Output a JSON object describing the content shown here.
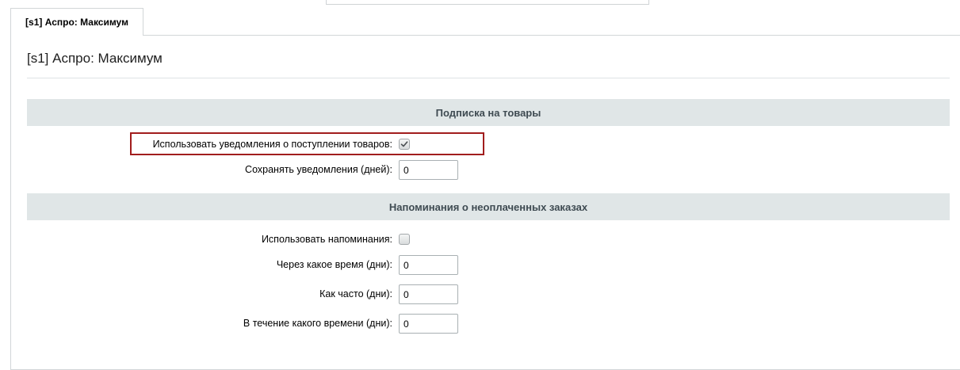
{
  "tabs": [
    {
      "label": "[s1] Аспро: Максимум",
      "active": true
    }
  ],
  "panel": {
    "title": "[s1] Аспро: Максимум"
  },
  "sections": {
    "subscribe": {
      "header": "Подписка на товары",
      "use_notifications_label": "Использовать уведомления о поступлении товаров:",
      "use_notifications_checked": true,
      "keep_days_label": "Сохранять уведомления (дней):",
      "keep_days_value": "0"
    },
    "reminders": {
      "header": "Напоминания о неоплаченных заказах",
      "use_reminders_label": "Использовать напоминания:",
      "use_reminders_checked": false,
      "after_label": "Через какое время (дни):",
      "after_value": "0",
      "frequency_label": "Как часто (дни):",
      "frequency_value": "0",
      "during_label": "В течение какого времени (дни):",
      "during_value": "0"
    }
  },
  "colors": {
    "section_header_bg": "#e0e6e7",
    "highlight_border": "#a11d1d"
  },
  "icons": {
    "checked": "checkmark-icon"
  }
}
